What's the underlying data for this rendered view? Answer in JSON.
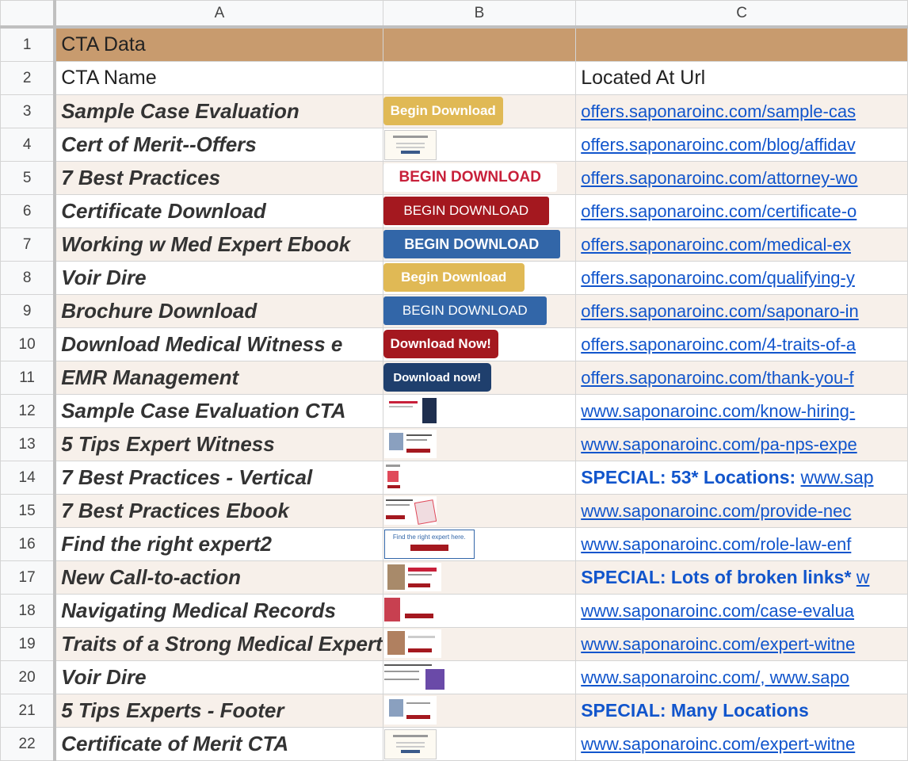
{
  "columns": [
    "A",
    "B",
    "C"
  ],
  "rows": [
    {
      "num": "1",
      "name": "CTA Data",
      "url": ""
    },
    {
      "num": "2",
      "name": "CTA Name",
      "url": "Located At Url"
    },
    {
      "num": "3",
      "name": "Sample Case Evaluation",
      "cta": "Begin Download",
      "url": "offers.saponaroinc.com/sample-cas"
    },
    {
      "num": "4",
      "name": "Cert of Merit--Offers",
      "url": "offers.saponaroinc.com/blog/affidav"
    },
    {
      "num": "5",
      "name": "7 Best Practices",
      "cta": "BEGIN DOWNLOAD",
      "url": "offers.saponaroinc.com/attorney-wo"
    },
    {
      "num": "6",
      "name": "Certificate Download",
      "cta": "BEGIN DOWNLOAD",
      "url": "offers.saponaroinc.com/certificate-o"
    },
    {
      "num": "7",
      "name": "Working w Med Expert Ebook",
      "cta": "BEGIN DOWNLOAD",
      "url": "offers.saponaroinc.com/medical-ex"
    },
    {
      "num": "8",
      "name": "Voir Dire",
      "cta": "Begin Download",
      "url": "offers.saponaroinc.com/qualifying-y"
    },
    {
      "num": "9",
      "name": "Brochure Download",
      "cta": "BEGIN DOWNLOAD",
      "url": "offers.saponaroinc.com/saponaro-in"
    },
    {
      "num": "10",
      "name": "Download Medical Witness e",
      "cta": "Download Now!",
      "url": "offers.saponaroinc.com/4-traits-of-a"
    },
    {
      "num": "11",
      "name": "EMR Management",
      "cta": "Download now!",
      "url": "offers.saponaroinc.com/thank-you-f"
    },
    {
      "num": "12",
      "name": "Sample Case Evaluation CTA",
      "url": "www.saponaroinc.com/know-hiring-"
    },
    {
      "num": "13",
      "name": "5 Tips Expert Witness",
      "url": "www.saponaroinc.com/pa-nps-expe"
    },
    {
      "num": "14",
      "name": "7 Best Practices - Vertical",
      "special": "SPECIAL: 53* Locations:",
      "url": "www.sap"
    },
    {
      "num": "15",
      "name": "7 Best Practices Ebook",
      "url": "www.saponaroinc.com/provide-nec"
    },
    {
      "num": "16",
      "name": "Find the right expert2",
      "thumb_text": "Find the right expert here.",
      "url": "www.saponaroinc.com/role-law-enf"
    },
    {
      "num": "17",
      "name": "New Call-to-action",
      "special": "SPECIAL: Lots of broken links*",
      "url": "w"
    },
    {
      "num": "18",
      "name": "Navigating Medical Records",
      "url": "www.saponaroinc.com/case-evalua"
    },
    {
      "num": "19",
      "name": "Traits of a Strong Medical Expert",
      "url": "www.saponaroinc.com/expert-witne"
    },
    {
      "num": "20",
      "name": "Voir Dire",
      "url": "www.saponaroinc.com/",
      "url2": ", www.sapo"
    },
    {
      "num": "21",
      "name": "5 Tips Experts - Footer",
      "special": "SPECIAL: Many Locations"
    },
    {
      "num": "22",
      "name": "Certificate of Merit CTA",
      "url": "www.saponaroinc.com/expert-witne"
    }
  ],
  "colors": {
    "header_fill": "#c89b6e",
    "band": "#f7f0ea",
    "link": "#1155cc"
  }
}
